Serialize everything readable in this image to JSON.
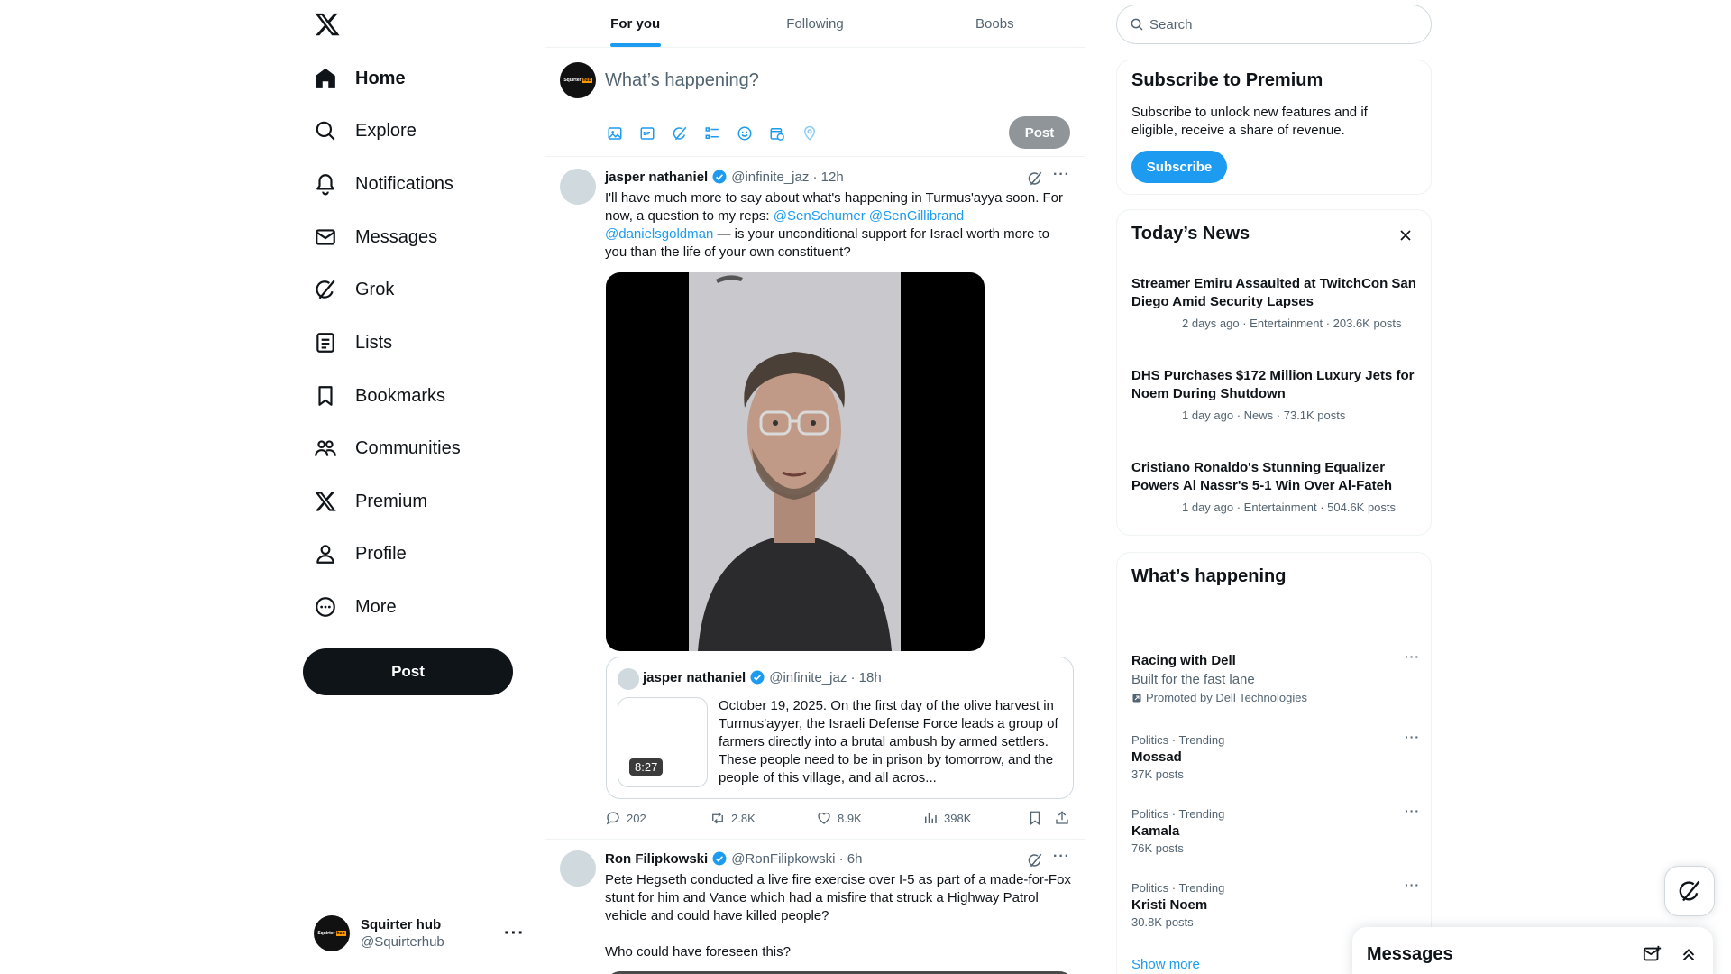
{
  "colors": {
    "accent": "#1d9bf0",
    "text": "#0f1419",
    "muted": "#536471"
  },
  "nav": {
    "items": [
      {
        "label": "Home",
        "icon": "home-icon"
      },
      {
        "label": "Explore",
        "icon": "search-icon"
      },
      {
        "label": "Notifications",
        "icon": "bell-icon"
      },
      {
        "label": "Messages",
        "icon": "envelope-icon"
      },
      {
        "label": "Grok",
        "icon": "grok-icon"
      },
      {
        "label": "Lists",
        "icon": "list-icon"
      },
      {
        "label": "Bookmarks",
        "icon": "bookmark-icon"
      },
      {
        "label": "Communities",
        "icon": "people-icon"
      },
      {
        "label": "Premium",
        "icon": "x-logo-icon"
      },
      {
        "label": "Profile",
        "icon": "person-icon"
      },
      {
        "label": "More",
        "icon": "more-circle-icon"
      }
    ],
    "post_label": "Post"
  },
  "account": {
    "avatar_text": "Squirter",
    "avatar_badge": "hub",
    "name": "Squirter hub",
    "handle": "@Squirterhub"
  },
  "tabs": [
    {
      "label": "For you"
    },
    {
      "label": "Following"
    },
    {
      "label": "Boobs"
    }
  ],
  "composer": {
    "placeholder": "What’s happening?",
    "post_label": "Post"
  },
  "posts": [
    {
      "name": "jasper nathaniel",
      "handle": "@infinite_jaz",
      "time": "12h",
      "text_1": "I'll have much more to say about what's happening in Turmus'ayya soon. For now, a question to my reps: ",
      "mention_1": "@SenSchumer",
      "mention_2": "@SenGillibrand",
      "mention_3": "@danielsgoldman",
      "text_2": " — is your unconditional support for Israel worth more to you than the life of your own constituent?",
      "quote": {
        "name": "jasper nathaniel",
        "handle": "@infinite_jaz",
        "time": "18h",
        "duration": "8:27",
        "text": "October 19, 2025. On the first day of the olive harvest in Turmus'ayyer, the Israeli Defense Force leads a group of farmers directly into a brutal ambush by armed settlers. These people need to be in prison by tomorrow, and the people of this village, and all acros..."
      },
      "replies": "202",
      "reposts": "2.8K",
      "likes": "8.9K",
      "views": "398K"
    },
    {
      "name": "Ron Filipkowski",
      "handle": "@RonFilipkowski",
      "time": "6h",
      "text": "Pete Hegseth conducted a live fire exercise over I-5 as part of a made-for-Fox stunt for him and Vance which had a misfire that struck a Highway Patrol vehicle and could have  killed people?",
      "text_2": "Who could have foreseen this?"
    }
  ],
  "right": {
    "search_placeholder": "Search",
    "premium": {
      "title": "Subscribe to Premium",
      "body": "Subscribe to unlock new features and if eligible, receive a share of revenue.",
      "button": "Subscribe"
    },
    "news": {
      "title": "Today’s News",
      "items": [
        {
          "title": "Streamer Emiru Assaulted at TwitchCon San Diego Amid Security Lapses",
          "meta": "2 days ago · Entertainment · 203.6K posts"
        },
        {
          "title": "DHS Purchases $172 Million Luxury Jets for Noem During Shutdown",
          "meta": "1 day ago · News · 73.1K posts"
        },
        {
          "title": "Cristiano Ronaldo's Stunning Equalizer Powers Al Nassr's 5-1 Win Over Al-Fateh",
          "meta": "1 day ago · Entertainment · 504.6K posts"
        }
      ]
    },
    "happening": {
      "title": "What’s happening",
      "promo": {
        "title": "Racing with Dell",
        "subtitle": "Built for the fast lane",
        "promoted": "Promoted by Dell Technologies"
      },
      "trends": [
        {
          "context": "Politics · Trending",
          "title": "Mossad",
          "count": "37K posts"
        },
        {
          "context": "Politics · Trending",
          "title": "Kamala",
          "count": "76K posts"
        },
        {
          "context": "Politics · Trending",
          "title": "Kristi Noem",
          "count": "30.8K posts"
        }
      ],
      "show_more": "Show more"
    }
  },
  "messages_drawer": {
    "title": "Messages"
  }
}
